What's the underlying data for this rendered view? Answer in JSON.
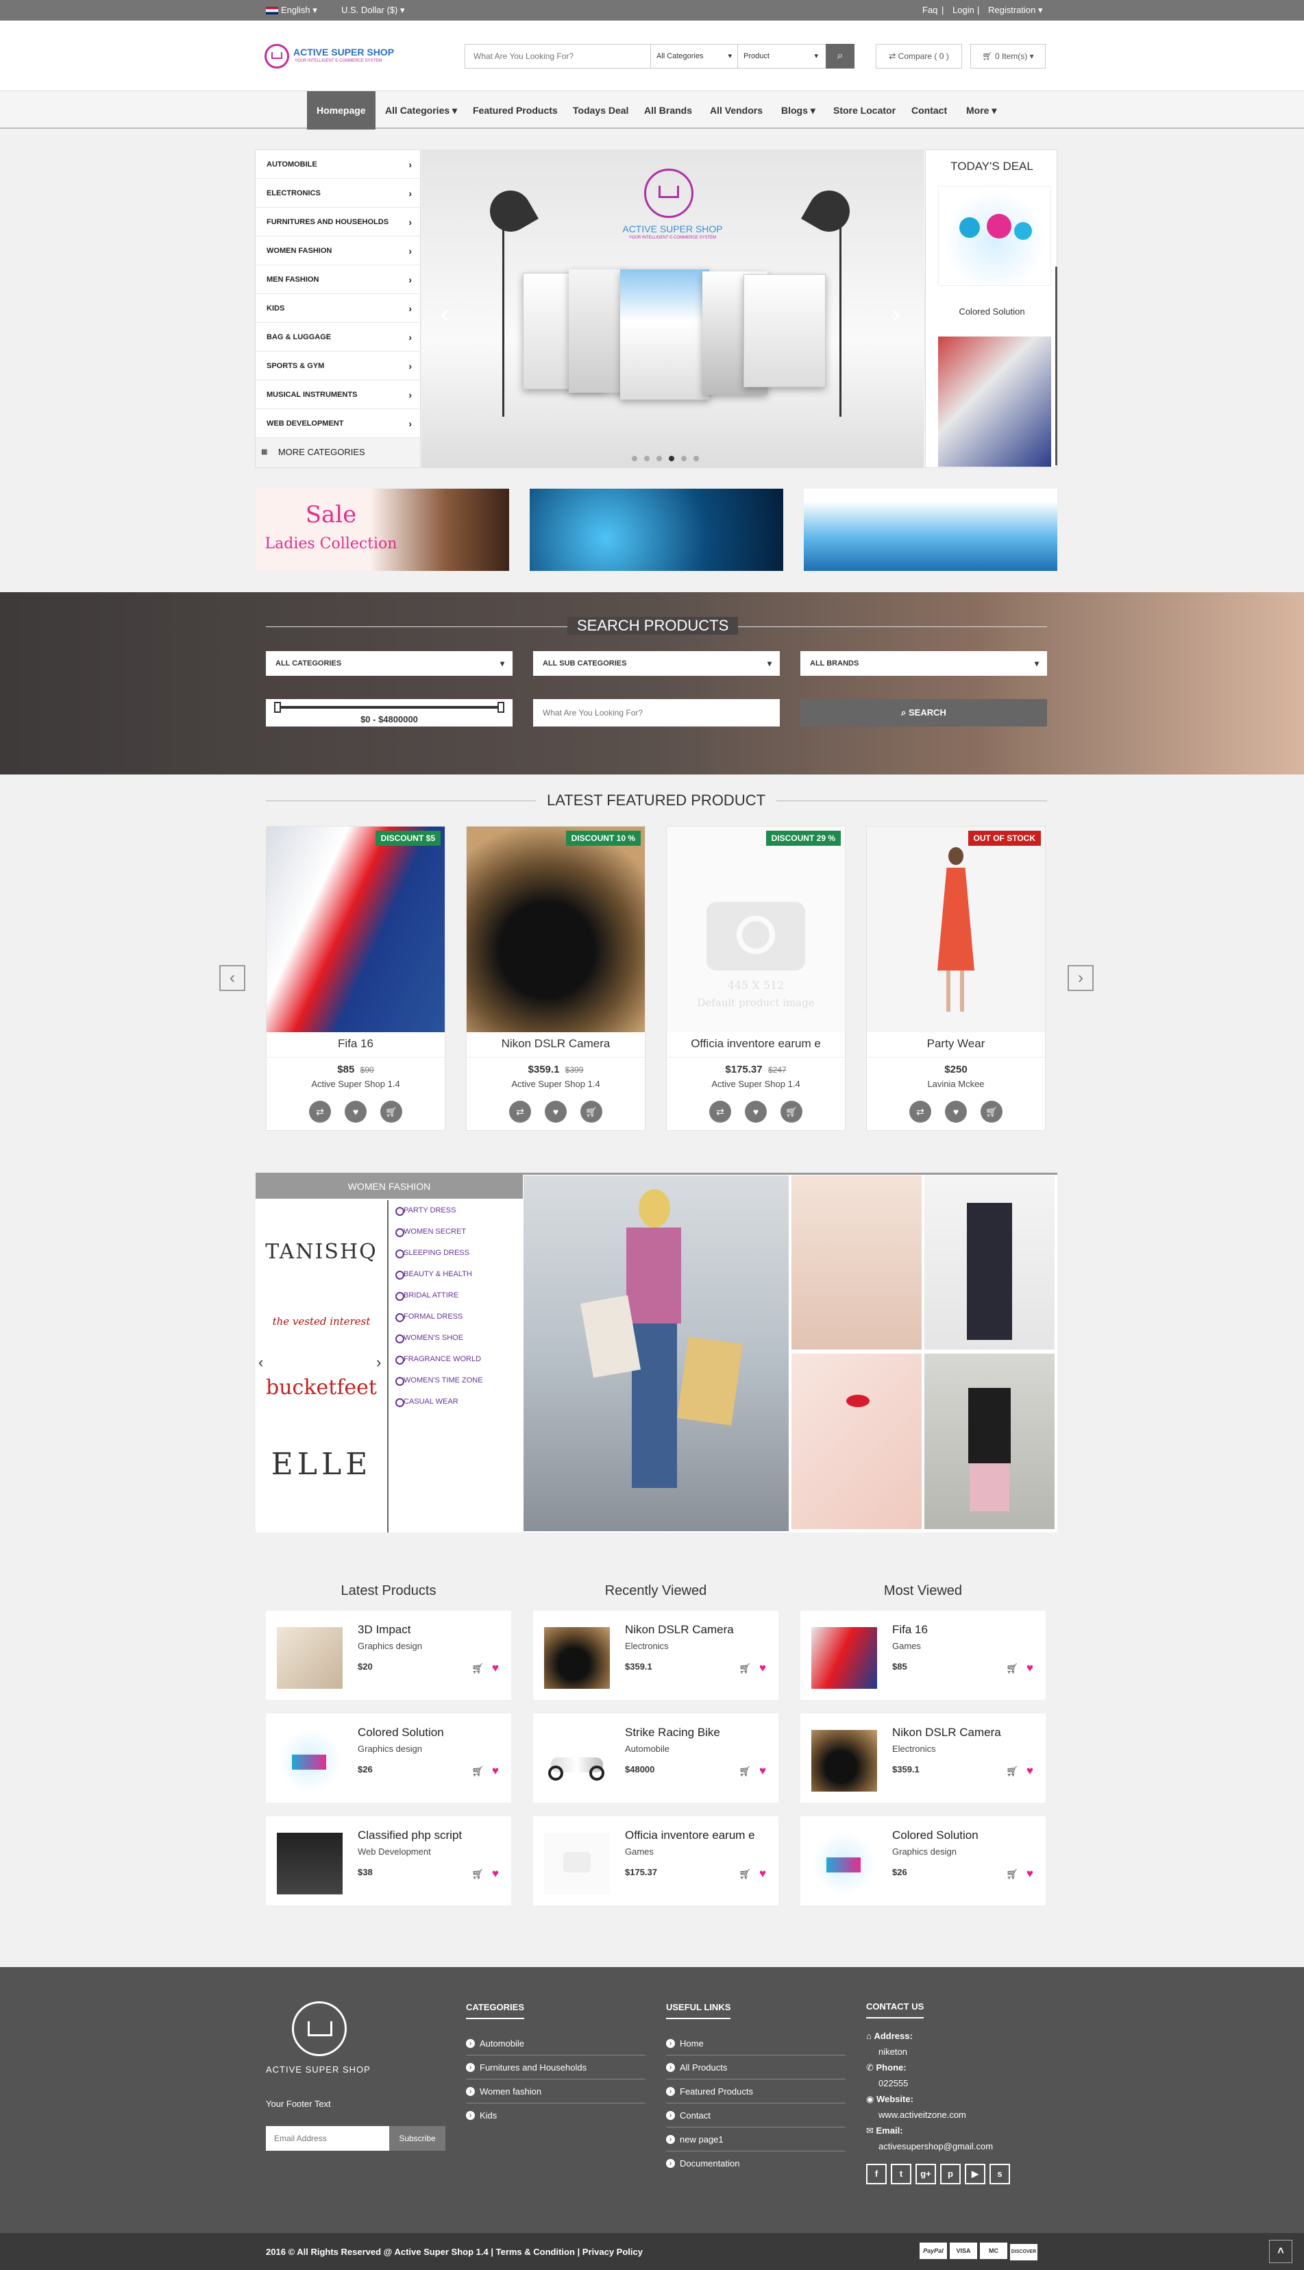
{
  "topbar": {
    "language": "English",
    "currency": "U.S. Dollar ($)",
    "faq": "Faq",
    "login": "Login",
    "registration": "Registration"
  },
  "header": {
    "logo_title": "ACTIVE SUPER SHOP",
    "logo_tagline": "YOUR INTELLIGENT E-COMMERCE SYSTEM",
    "search_placeholder": "What Are You Looking For?",
    "category_select": "All Categories",
    "type_select": "Product",
    "compare": "Compare ( 0 )",
    "cart": "0 Item(s)"
  },
  "nav": [
    "Homepage",
    "All Categories",
    "Featured Products",
    "Todays Deal",
    "All Brands",
    "All Vendors",
    "Blogs",
    "Store Locator",
    "Contact",
    "More"
  ],
  "sidebar": {
    "categories": [
      "AUTOMOBILE",
      "ELECTRONICS",
      "FURNITURES AND HOUSEHOLDS",
      "WOMEN FASHION",
      "MEN FASHION",
      "KIDS",
      "BAG & LUGGAGE",
      "SPORTS & GYM",
      "MUSICAL INSTRUMENTS",
      "WEB DEVELOPMENT"
    ],
    "more": "MORE CATEGORIES"
  },
  "slider": {
    "logo_title": "ACTIVE SUPER SHOP",
    "logo_tagline": "YOUR INTELLIGENT E-COMMERCE SYSTEM",
    "dots": 6,
    "active_dot": 4
  },
  "todays_deal": {
    "title": "TODAY'S DEAL",
    "items": [
      "Colored Solution"
    ]
  },
  "banners": {
    "sale": "Sale",
    "ladies": "Ladies Collection"
  },
  "search_products": {
    "title": "SEARCH PRODUCTS",
    "all_categories": "ALL CATEGORIES",
    "all_sub_categories": "ALL SUB CATEGORIES",
    "all_brands": "ALL BRANDS",
    "price_range": "$0 - $4800000",
    "placeholder": "What Are You Looking For?",
    "button": "SEARCH"
  },
  "featured": {
    "title": "LATEST FEATURED PRODUCT",
    "products": [
      {
        "name": "Fifa 16",
        "price": "$85",
        "old_price": "$90",
        "vendor": "Active Super Shop 1.4",
        "badge": "DISCOUNT $5",
        "badge_color": "#1e8a4c"
      },
      {
        "name": "Nikon DSLR Camera",
        "price": "$359.1",
        "old_price": "$399",
        "vendor": "Active Super Shop 1.4",
        "badge": "DISCOUNT 10 %",
        "badge_color": "#1e8a4c"
      },
      {
        "name": "Officia inventore earum e",
        "price": "$175.37",
        "old_price": "$247",
        "vendor": "Active Super Shop 1.4",
        "badge": "DISCOUNT 29 %",
        "badge_color": "#1e8a4c",
        "placeholder_size": "445 X 512",
        "placeholder_text": "Default product image"
      },
      {
        "name": "Party Wear",
        "price": "$250",
        "old_price": "",
        "vendor": "Lavinia Mckee",
        "badge": "OUT OF STOCK",
        "badge_color": "#c9201e"
      }
    ]
  },
  "women_fashion": {
    "title": "WOMEN FASHION",
    "brands": [
      "TANISHQ",
      "the vested interest",
      "bucketfeet",
      "ELLE"
    ],
    "links": [
      "PARTY DRESS",
      "WOMEN SECRET",
      "SLEEPING DRESS",
      "BEAUTY & HEALTH",
      "BRIDAL ATTIRE",
      "FORMAL DRESS",
      "WOMEN'S SHOE",
      "FRAGRANCE WORLD",
      "WOMEN'S TIME ZONE",
      "CASUAL WEAR"
    ]
  },
  "lists": [
    {
      "title": "Latest Products",
      "items": [
        {
          "name": "3D Impact",
          "cat": "Graphics design",
          "price": "$20"
        },
        {
          "name": "Colored Solution",
          "cat": "Graphics design",
          "price": "$26"
        },
        {
          "name": "Classified php script",
          "cat": "Web Development",
          "price": "$38"
        }
      ]
    },
    {
      "title": "Recently Viewed",
      "items": [
        {
          "name": "Nikon DSLR Camera",
          "cat": "Electronics",
          "price": "$359.1"
        },
        {
          "name": "Strike Racing Bike",
          "cat": "Automobile",
          "price": "$48000"
        },
        {
          "name": "Officia inventore earum e",
          "cat": "Games",
          "price": "$175.37"
        }
      ]
    },
    {
      "title": "Most Viewed",
      "items": [
        {
          "name": "Fifa 16",
          "cat": "Games",
          "price": "$85"
        },
        {
          "name": "Nikon DSLR Camera",
          "cat": "Electronics",
          "price": "$359.1"
        },
        {
          "name": "Colored Solution",
          "cat": "Graphics design",
          "price": "$26"
        }
      ]
    }
  ],
  "footer": {
    "logo_title": "ACTIVE SUPER SHOP",
    "footer_text": "Your Footer Text",
    "email_placeholder": "Email Address",
    "subscribe": "Subscribe",
    "categories_title": "CATEGORIES",
    "categories": [
      "Automobile",
      "Furnitures and Households",
      "Women fashion",
      "Kids"
    ],
    "useful_title": "USEFUL LINKS",
    "useful": [
      "Home",
      "All Products",
      "Featured Products",
      "Contact",
      "new page1",
      "Documentation"
    ],
    "contact_title": "CONTACT US",
    "address_label": "Address:",
    "address": "niketon",
    "phone_label": "Phone:",
    "phone": "022555",
    "website_label": "Website:",
    "website": "www.activeitzone.com",
    "email_label": "Email:",
    "email": "activesupershop@gmail.com",
    "social": [
      "facebook-icon",
      "twitter-icon",
      "google-plus-icon",
      "pinterest-icon",
      "youtube-icon",
      "skype-icon"
    ]
  },
  "bottom": {
    "copyright": "2016 © All Rights Reserved @ Active Super Shop 1.4",
    "terms": "Terms & Condition",
    "privacy": "Privacy Policy",
    "payments": [
      "PayPal",
      "VISA",
      "MC",
      "DISCOVER"
    ]
  }
}
